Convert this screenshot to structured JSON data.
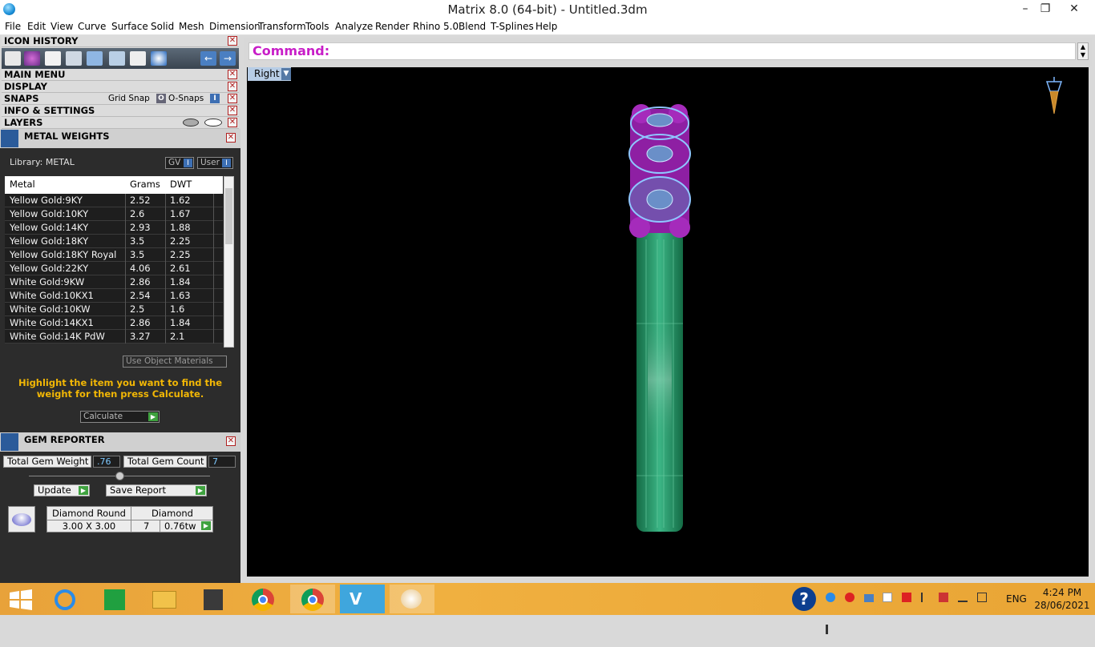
{
  "window": {
    "title": "Matrix 8.0 (64-bit) - Untitled.3dm",
    "min": "–",
    "max": "❐",
    "close": "✕"
  },
  "menu": [
    "File",
    "Edit",
    "View",
    "Curve",
    "Surface",
    "Solid",
    "Mesh",
    "Dimension",
    "Transform",
    "Tools",
    "Analyze",
    "Render",
    "Rhino 5.0",
    "Blend",
    "T-Splines",
    "Help"
  ],
  "panel": {
    "icon_history": "ICON HISTORY",
    "main_menu": "MAIN MENU",
    "display": "DISPLAY",
    "snaps": "SNAPS",
    "grid_snap": "Grid Snap",
    "o_snaps": "O-Snaps",
    "info_settings": "INFO & SETTINGS",
    "layers": "LAYERS"
  },
  "metal_weights": {
    "title": "METAL WEIGHTS",
    "library": "Library: METAL",
    "gv": "GV",
    "user": "User",
    "columns": [
      "Metal",
      "Grams",
      "DWT"
    ],
    "rows": [
      [
        "Yellow Gold:9KY",
        "2.52",
        "1.62"
      ],
      [
        "Yellow Gold:10KY",
        "2.6",
        "1.67"
      ],
      [
        "Yellow Gold:14KY",
        "2.93",
        "1.88"
      ],
      [
        "Yellow Gold:18KY",
        "3.5",
        "2.25"
      ],
      [
        "Yellow Gold:18KY Royal",
        "3.5",
        "2.25"
      ],
      [
        "Yellow Gold:22KY",
        "4.06",
        "2.61"
      ],
      [
        "White Gold:9KW",
        "2.86",
        "1.84"
      ],
      [
        "White Gold:10KX1",
        "2.54",
        "1.63"
      ],
      [
        "White Gold:10KW",
        "2.5",
        "1.6"
      ],
      [
        "White Gold:14KX1",
        "2.86",
        "1.84"
      ],
      [
        "White Gold:14K PdW",
        "3.27",
        "2.1"
      ]
    ],
    "use_object_materials": "Use Object Materials",
    "hint": "Highlight the item you want to find the weight for then press Calculate.",
    "calculate": "Calculate"
  },
  "gem_reporter": {
    "title": "GEM REPORTER",
    "total_weight_label": "Total Gem Weight",
    "total_weight": ".76",
    "total_count_label": "Total Gem Count",
    "total_count": "7",
    "update": "Update",
    "save_report": "Save Report",
    "gem_name": "Diamond Round",
    "gem_type": "Diamond",
    "gem_size": "3.00 X 3.00",
    "gem_qty": "7",
    "gem_tw": "0.76tw"
  },
  "command": {
    "label": "Command:"
  },
  "viewport": {
    "name": "Right"
  },
  "taskbar": {
    "lang": "ENG",
    "time": "4:24 PM",
    "date": "28/06/2021"
  },
  "colors": {
    "prong": "#8e1fa3",
    "gem_wire": "#8fc6ff",
    "shank": "#1f8a5c",
    "command": "#c81ec8",
    "hint": "#f2b705"
  }
}
